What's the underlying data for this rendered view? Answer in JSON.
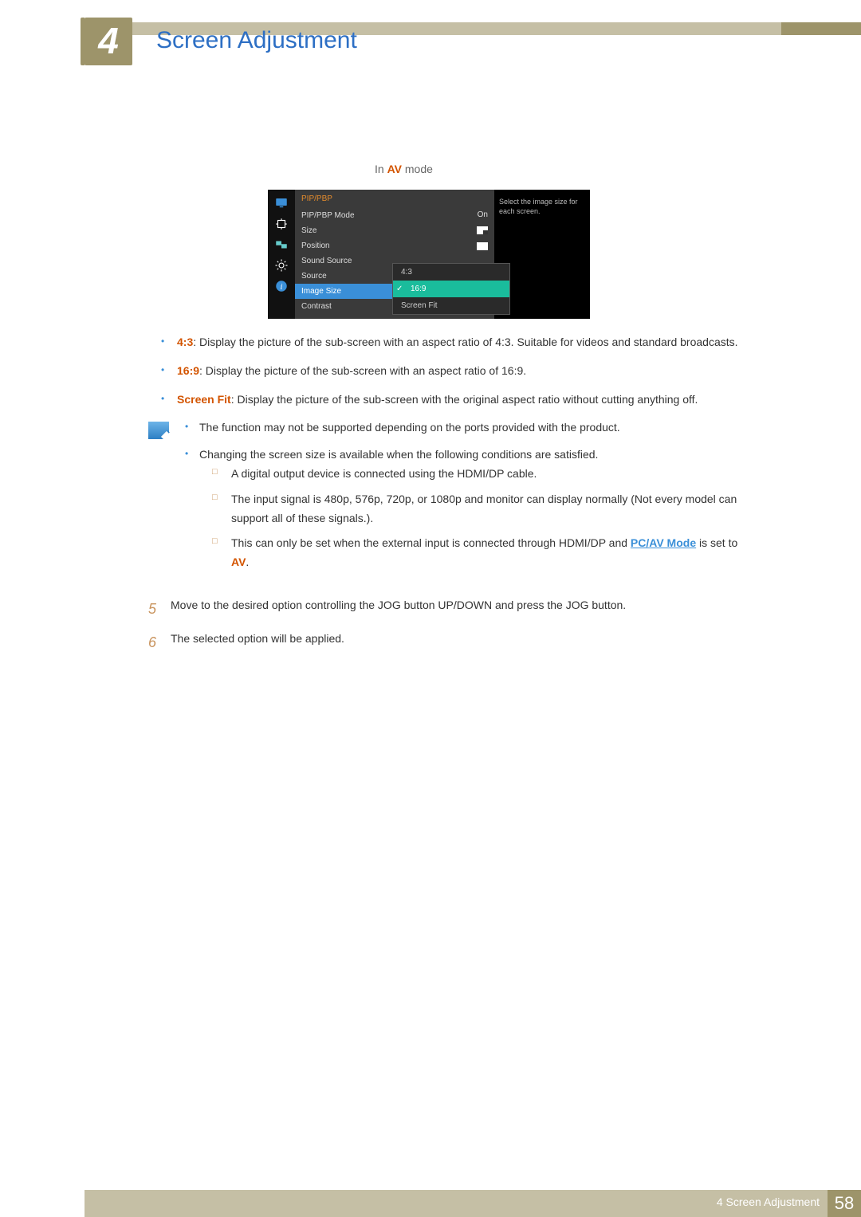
{
  "chapter": {
    "number": "4",
    "title": "Screen Adjustment"
  },
  "mode": {
    "prefix": "In ",
    "accent": "AV",
    "suffix": " mode"
  },
  "osd": {
    "header": "PIP/PBP",
    "help": "Select the image size for each screen.",
    "items": {
      "mode": {
        "label": "PIP/PBP Mode",
        "value": "On"
      },
      "size": {
        "label": "Size"
      },
      "pos": {
        "label": "Position"
      },
      "sound": {
        "label": "Sound Source"
      },
      "source": {
        "label": "Source"
      },
      "image": {
        "label": "Image Size"
      },
      "contrast": {
        "label": "Contrast"
      }
    },
    "submenu": {
      "a": "4:3",
      "b": "16:9",
      "c": "Screen Fit"
    }
  },
  "bullets": {
    "a": {
      "term": "4:3",
      "text": ": Display the picture of the sub-screen with an aspect ratio of 4:3. Suitable for videos and standard broadcasts."
    },
    "b": {
      "term": "16:9",
      "text": ": Display the picture of the sub-screen with an aspect ratio of 16:9."
    },
    "c": {
      "term": "Screen Fit",
      "text": ": Display the picture of the sub-screen with the original aspect ratio without cutting anything off."
    }
  },
  "note": {
    "n1": "The function may not be supported depending on the ports provided with the product.",
    "n2": "Changing the screen size is available when the following conditions are satisfied.",
    "s1": "A digital output device is connected using the HDMI/DP cable.",
    "s2": "The input signal is 480p, 576p, 720p, or 1080p and monitor can display normally (Not every model can support all of these signals.).",
    "s3a": "This can only be set when the external input is connected through HDMI/DP and ",
    "s3link": "PC/AV Mode",
    "s3b": " is set to ",
    "s3accent": "AV",
    "s3c": "."
  },
  "steps": {
    "s5num": "5",
    "s5": "Move to the desired option controlling the JOG button UP/DOWN and press the JOG button.",
    "s6num": "6",
    "s6": "The selected option will be applied."
  },
  "footer": {
    "label": "4 Screen Adjustment",
    "page": "58"
  }
}
